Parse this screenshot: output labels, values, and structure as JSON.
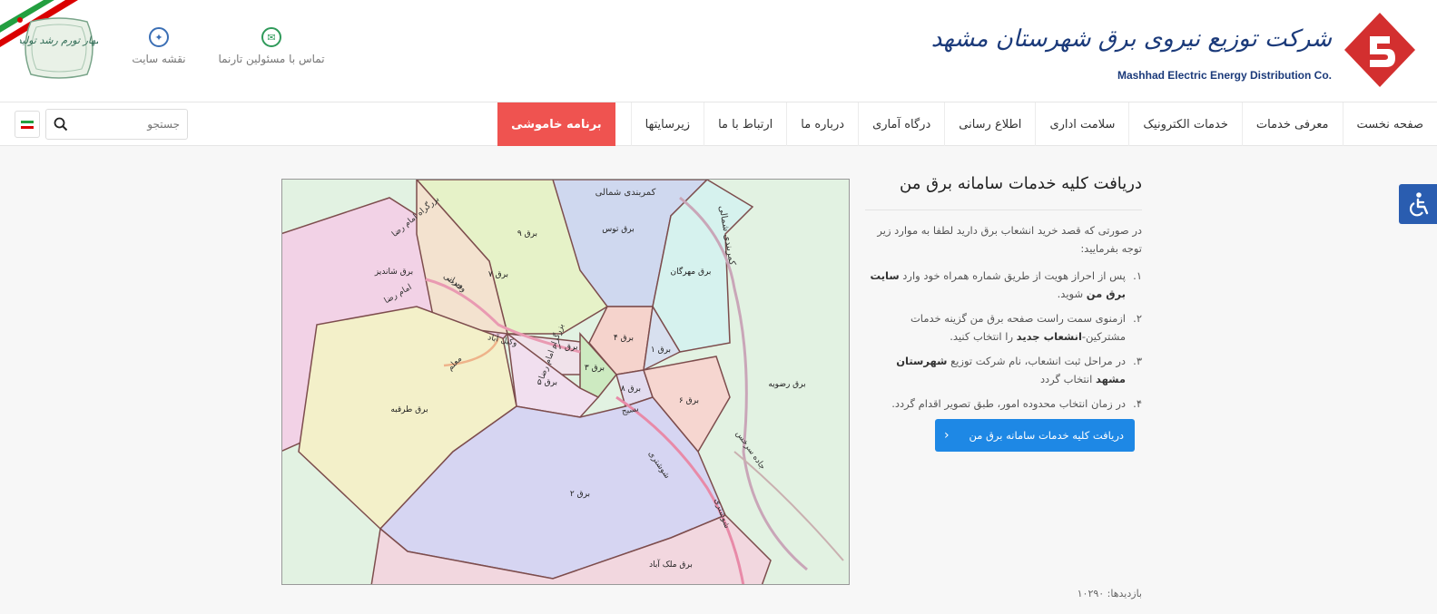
{
  "header": {
    "logo_fa": "شرکت توزیع نیروی برق شهرستان مشهد",
    "logo_en": "Mashhad Electric Energy Distribution Co.",
    "top_links": [
      {
        "label": "نقشه سایت",
        "icon": "sitemap-icon"
      },
      {
        "label": "تماس با مسئولین تارنما",
        "icon": "contact-icon"
      }
    ],
    "emblem_text": "مهار تورم رشد تولید"
  },
  "nav": {
    "items": [
      "صفحه نخست",
      "معرفی خدمات",
      "خدمات الکترونیک",
      "سلامت اداری",
      "اطلاع رسانی",
      "درگاه آماری",
      "درباره ما",
      "ارتباط با ما",
      "زیرسایتها"
    ],
    "highlight": "برنامه خاموشی",
    "search_placeholder": "جستجو"
  },
  "colors": {
    "brand_red": "#d32f2f",
    "brand_blue": "#1b3a7a",
    "highlight_red": "#ef5350",
    "cta_blue": "#1e88e5",
    "a11y_blue": "#2a5db0"
  },
  "article": {
    "title": "دریافت کلیه خدمات سامانه برق من",
    "intro": "در صورتی که قصد خرید انشعاب برق دارید لطفا به موارد زیر توجه بفرمایید:",
    "steps": [
      {
        "num": "۱.",
        "pre": "پس از احراز هویت از طریق شماره همراه خود وارد ",
        "bold": "سایت برق من",
        "post": " شوید."
      },
      {
        "num": "۲.",
        "pre": "ازمنوی سمت راست صفحه برق من گزینه خدمات مشترکین-",
        "bold": "انشعاب جدید",
        "post": " را انتخاب کنید."
      },
      {
        "num": "۳.",
        "pre": "در مراحل ثبت انشعاب، نام شرکت توزیع ",
        "bold": "شهرستان مشهد",
        "post": " انتخاب گردد"
      },
      {
        "num": "۴.",
        "pre": "در زمان انتخاب محدوده امور، طبق تصویر اقدام گردد.",
        "bold": "",
        "post": ""
      }
    ],
    "cta_label": "دریافت کلیه خدمات سامانه برق من",
    "visits_label": "بازدیدها:",
    "visits_value": "۱۰۲۹۰"
  },
  "map": {
    "regions": [
      "برق توس",
      "برق ۹",
      "برق ۷",
      "برق شاندیز",
      "برق مهرگان",
      "برق ۴",
      "برق ۱",
      "برق ۱۱",
      "برق ۳",
      "برق ۵",
      "برق ۸",
      "برق ۶",
      "برق رضویه",
      "برق طرقبه",
      "برق ۲",
      "برق ملک آباد"
    ],
    "roads": [
      "کمربندی شمالی",
      "کمربندی شمالی",
      "بزرگراه امام رضا",
      "بزرگراه امام رضا",
      "وکیل آباد",
      "وحدت",
      "جاده سرخس",
      "شوشتری",
      "شوشتری",
      "بسیج",
      "امام رضا",
      "ویرانی",
      "معلم"
    ]
  }
}
